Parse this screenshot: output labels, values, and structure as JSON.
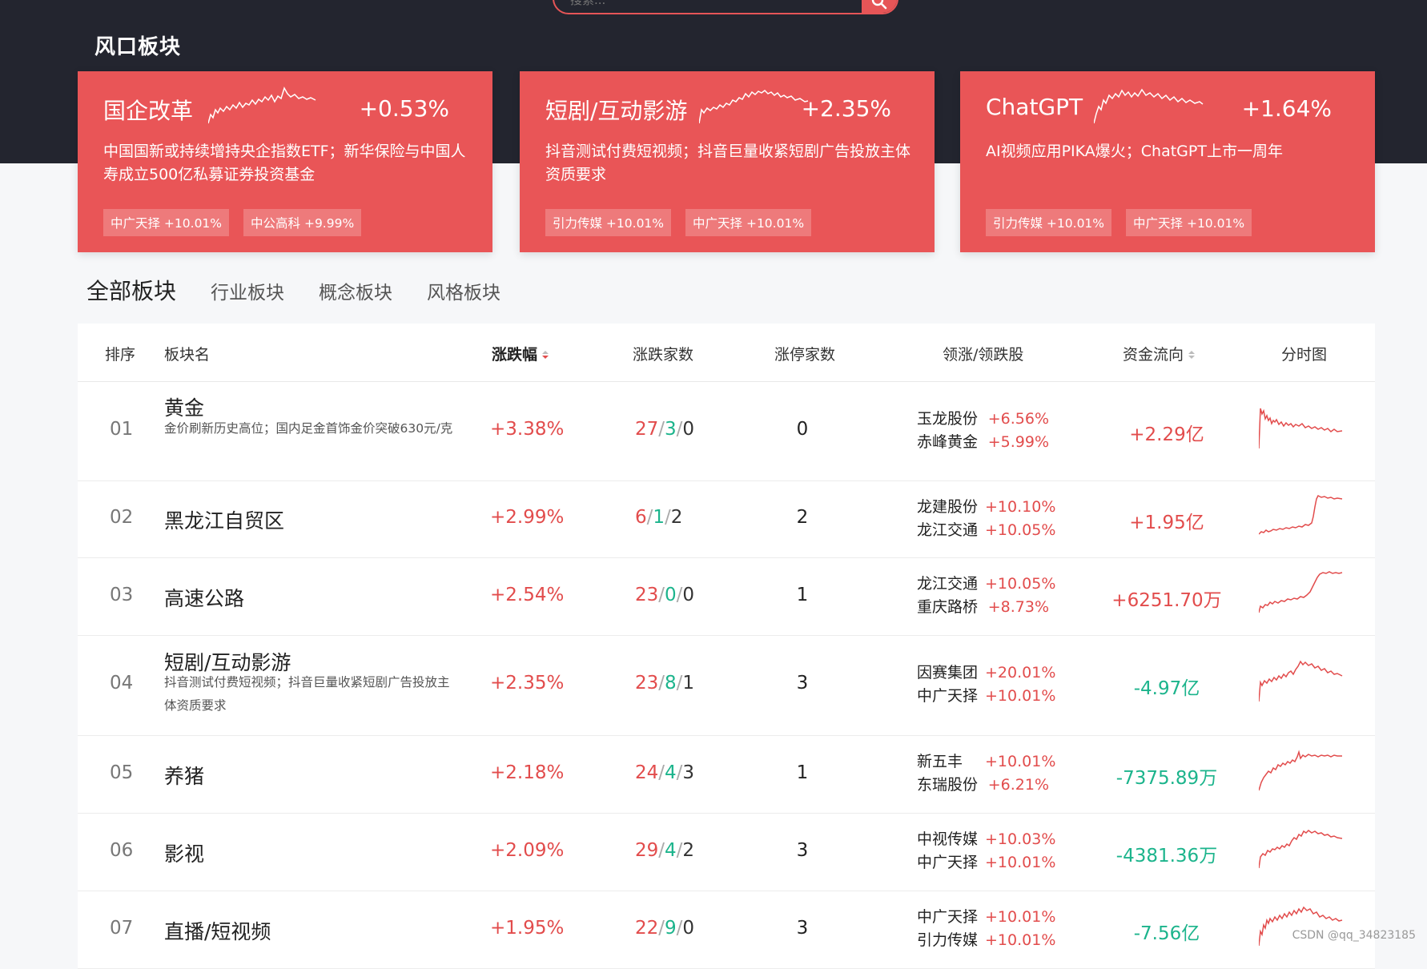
{
  "search": {
    "placeholder": "搜索..."
  },
  "section_title": "风口板块",
  "cards": [
    {
      "name": "国企改革",
      "pct": "+0.53%",
      "desc": "中国国新或持续增持央企指数ETF；新华保险与中国人寿成立500亿私募证券投资基金",
      "tags": [
        "中广天择 +10.01%",
        "中公高科 +9.99%"
      ]
    },
    {
      "name": "短剧/互动影游",
      "pct": "+2.35%",
      "desc": "抖音测试付费短视频；抖音巨量收紧短剧广告投放主体资质要求",
      "tags": [
        "引力传媒 +10.01%",
        "中广天择 +10.01%"
      ]
    },
    {
      "name": "ChatGPT",
      "pct": "+1.64%",
      "desc": "AI视频应用PIKA爆火；ChatGPT上市一周年",
      "tags": [
        "引力传媒 +10.01%",
        "中广天择 +10.01%"
      ]
    }
  ],
  "tabs": [
    "全部板块",
    "行业板块",
    "概念板块",
    "风格板块"
  ],
  "table": {
    "headers": {
      "idx": "排序",
      "name": "板块名",
      "pct": "涨跌幅",
      "ud": "涨跌家数",
      "limit": "涨停家数",
      "lead": "领涨/领跌股",
      "flow": "资金流向",
      "chart": "分时图"
    },
    "rows": [
      {
        "idx": "01",
        "name": "黄金",
        "desc": "金价刷新历史高位；国内足金首饰金价突破630元/克",
        "pct": "+3.38%",
        "up": "27",
        "flat": "3",
        "down": "0",
        "limit": "0",
        "lead": [
          {
            "name": "玉龙股份",
            "pct": "+6.56%"
          },
          {
            "name": "赤峰黄金",
            "pct": "+5.99%"
          }
        ],
        "flow": "+2.29亿",
        "flow_dir": "in"
      },
      {
        "idx": "02",
        "name": "黑龙江自贸区",
        "desc": "",
        "pct": "+2.99%",
        "up": "6",
        "flat": "1",
        "down": "2",
        "limit": "2",
        "lead": [
          {
            "name": "龙建股份",
            "pct": "+10.10%"
          },
          {
            "name": "龙江交通",
            "pct": "+10.05%"
          }
        ],
        "flow": "+1.95亿",
        "flow_dir": "in"
      },
      {
        "idx": "03",
        "name": "高速公路",
        "desc": "",
        "pct": "+2.54%",
        "up": "23",
        "flat": "0",
        "down": "0",
        "limit": "1",
        "lead": [
          {
            "name": "龙江交通",
            "pct": "+10.05%"
          },
          {
            "name": "重庆路桥",
            "pct": "+8.73%"
          }
        ],
        "flow": "+6251.70万",
        "flow_dir": "in"
      },
      {
        "idx": "04",
        "name": "短剧/互动影游",
        "desc": "抖音测试付费短视频；抖音巨量收紧短剧广告投放主体资质要求",
        "pct": "+2.35%",
        "up": "23",
        "flat": "8",
        "down": "1",
        "limit": "3",
        "lead": [
          {
            "name": "因赛集团",
            "pct": "+20.01%"
          },
          {
            "name": "中广天择",
            "pct": "+10.01%"
          }
        ],
        "flow": "-4.97亿",
        "flow_dir": "out"
      },
      {
        "idx": "05",
        "name": "养猪",
        "desc": "",
        "pct": "+2.18%",
        "up": "24",
        "flat": "4",
        "down": "3",
        "limit": "1",
        "lead": [
          {
            "name": "新五丰",
            "pct": "+10.01%"
          },
          {
            "name": "东瑞股份",
            "pct": "+6.21%"
          }
        ],
        "flow": "-7375.89万",
        "flow_dir": "out"
      },
      {
        "idx": "06",
        "name": "影视",
        "desc": "",
        "pct": "+2.09%",
        "up": "29",
        "flat": "4",
        "down": "2",
        "limit": "3",
        "lead": [
          {
            "name": "中视传媒",
            "pct": "+10.03%"
          },
          {
            "name": "中广天择",
            "pct": "+10.01%"
          }
        ],
        "flow": "-4381.36万",
        "flow_dir": "out"
      },
      {
        "idx": "07",
        "name": "直播/短视频",
        "desc": "",
        "pct": "+1.95%",
        "up": "22",
        "flat": "9",
        "down": "0",
        "limit": "3",
        "lead": [
          {
            "name": "中广天择",
            "pct": "+10.01%"
          },
          {
            "name": "引力传媒",
            "pct": "+10.01%"
          }
        ],
        "flow": "-7.56亿",
        "flow_dir": "out"
      }
    ]
  },
  "colors": {
    "accent": "#e95557",
    "rise": "#e24c4c",
    "fall": "#1cb48c",
    "dark_bg": "#23252f"
  },
  "watermark": "CSDN @qq_34823185"
}
